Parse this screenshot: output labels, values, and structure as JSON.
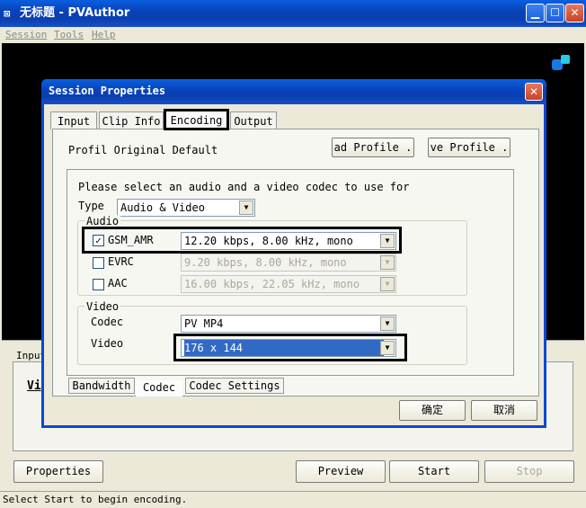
{
  "window": {
    "title": "无标题 - PVAuthor",
    "icon_glyph": "⊠"
  },
  "menu": [
    "Session",
    "Tools",
    "Help"
  ],
  "dialog": {
    "title": "Session Properties",
    "close_glyph": "✕",
    "tabs": [
      "Input",
      "Clip Info",
      "Encoding",
      "Output"
    ],
    "active_tab": "Encoding",
    "profile_label": "Profil Original Default",
    "load_profile": "ad Profile .",
    "save_profile": "ve Profile .",
    "prompt": "Please select an audio and a video codec to use for",
    "type_label": "Type",
    "type_value": "Audio & Video",
    "audio": {
      "group_label": "Audio",
      "codecs": [
        {
          "name": "GSM_AMR",
          "checked": true,
          "value": "12.20 kbps, 8.00 kHz, mono",
          "enabled": true
        },
        {
          "name": "EVRC",
          "checked": false,
          "value": "9.20 kbps, 8.00 kHz, mono",
          "enabled": false
        },
        {
          "name": "AAC",
          "checked": false,
          "value": "16.00 kbps, 22.05 kHz, mono",
          "enabled": false
        }
      ]
    },
    "video": {
      "group_label": "Video",
      "codec_label": "Codec",
      "codec_value": "PV MP4",
      "video_label": "Video",
      "video_value": "176 x 144"
    },
    "subtabs": [
      "Bandwidth",
      "Codec",
      "Codec Settings"
    ],
    "ok_label": "确定",
    "cancel_label": "取消"
  },
  "main": {
    "input_tab_partial": "Input",
    "vi_partial": "Vi",
    "properties_label": "Properties",
    "preview_label": "Preview",
    "start_label": "Start",
    "stop_label": "Stop"
  },
  "status": "Select Start to begin encoding.",
  "colors": {
    "titlebar": "#0a49d0",
    "face": "#ece9d8",
    "selection": "#316ac5",
    "highlight_box": "#000000"
  }
}
